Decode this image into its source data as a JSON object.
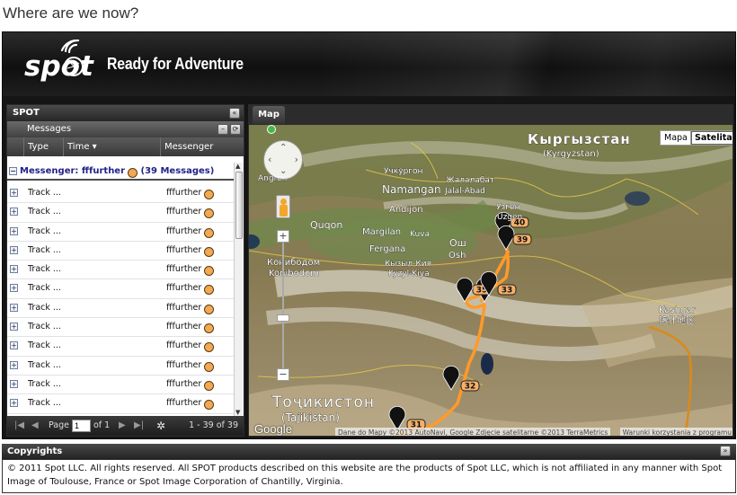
{
  "page": {
    "heading": "Where are we now?"
  },
  "banner": {
    "logo_text": "spot",
    "tagline": "Ready for Adventure"
  },
  "spot_panel": {
    "title": "SPOT",
    "messages_label": "Messages",
    "columns": {
      "type": "Type",
      "time": "Time",
      "messenger": "Messenger"
    },
    "group": {
      "prefix": "Messenger:",
      "name": "fffurther",
      "count": "(39 Messages)"
    },
    "rows": [
      {
        "type": "Track ...",
        "messenger": "fffurther"
      },
      {
        "type": "Track ...",
        "messenger": "fffurther"
      },
      {
        "type": "Track ...",
        "messenger": "fffurther"
      },
      {
        "type": "Track ...",
        "messenger": "fffurther"
      },
      {
        "type": "Track ...",
        "messenger": "fffurther"
      },
      {
        "type": "Track ...",
        "messenger": "fffurther"
      },
      {
        "type": "Track ...",
        "messenger": "fffurther"
      },
      {
        "type": "Track ...",
        "messenger": "fffurther"
      },
      {
        "type": "Track ...",
        "messenger": "fffurther"
      },
      {
        "type": "Track ...",
        "messenger": "fffurther"
      },
      {
        "type": "Track ...",
        "messenger": "fffurther"
      },
      {
        "type": "Track ...",
        "messenger": "fffurther"
      }
    ],
    "pager": {
      "page_label": "Page",
      "page_value": "1",
      "of_label": "of 1",
      "range": "1 - 39 of 39"
    }
  },
  "map_panel": {
    "tab": "Map",
    "map_type_map": "Mapa",
    "map_type_satellite": "Satelita",
    "labels": {
      "kyrgyzstan": "Кыргызстан",
      "kyrgyzstan_en": "(Kyrgyzstan)",
      "tajikistan": "Тоҷикистон",
      "tajikistan_en": "(Tajikistan)",
      "uchkurgon": "Учкўргон",
      "namangan": "Namangan",
      "andijon": "Andijon",
      "jalalabat": "Жалалабат",
      "jalalabad_en": "Jalal-Abad",
      "uzgen": "Узген",
      "uzgen_en": "Uzgen",
      "quqon": "Quqon",
      "margilan": "Margilan",
      "kuva": "Kuva",
      "fergana": "Fergana",
      "osh": "Ош",
      "osh_en": "Osh",
      "kyzylkiya": "Кызыл-Кия",
      "kyzylkiya_en": "Kyzyl-Kiya",
      "konibodom": "Конибодом",
      "konibodom_en": "Konibodom",
      "kashgar": "Kashgar",
      "kashgar_zh": "喀什地区",
      "angren": "Angren"
    },
    "markers": [
      "40",
      "39",
      "35",
      "33",
      "32",
      "31"
    ],
    "attribution": "Dane do Mapy ©2013 AutoNavi, Google Zdjęcie satelitarne ©2013 TerraMetrics",
    "terms": "Warunki korzystania z programu",
    "google": "Google"
  },
  "copyrights": {
    "title": "Copyrights",
    "text": "© 2011 Spot LLC. All rights reserved. All SPOT products described on this website are the products of Spot LLC, which is not affiliated in any manner with Spot Image of Toulouse, France or Spot Image Corporation of Chantilly, Virginia."
  }
}
